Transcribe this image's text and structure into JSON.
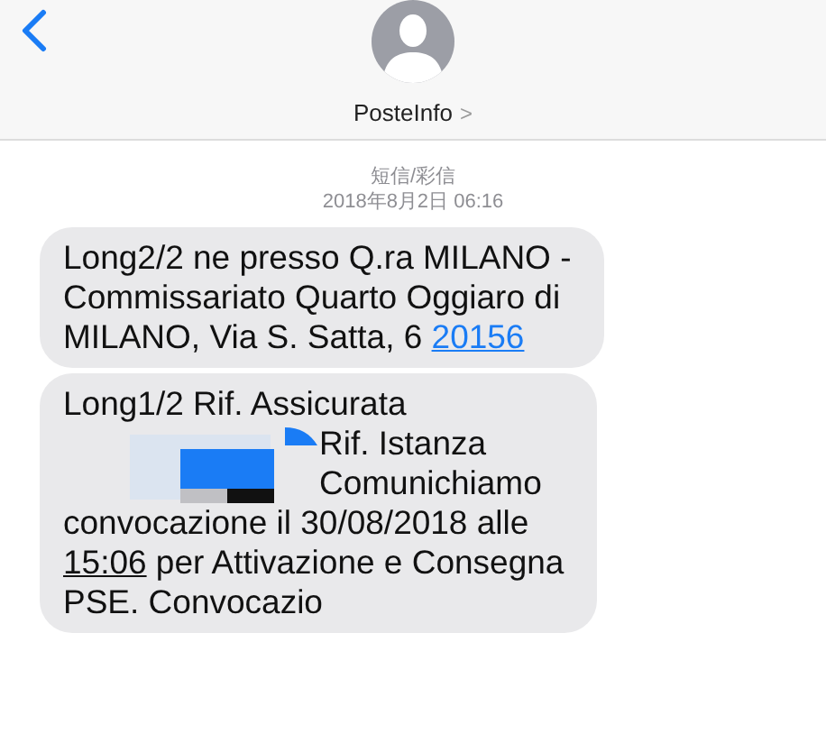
{
  "header": {
    "contact_name": "PosteInfo",
    "chevron": ">"
  },
  "thread_label": "短信/彩信",
  "timestamp": "2018年8月2日 06:16",
  "messages": [
    {
      "lines": [
        {
          "kind": "text",
          "segments": [
            {
              "kind": "plain",
              "text": "Long2/2 ne presso Q.ra MILANO -"
            }
          ]
        },
        {
          "kind": "text",
          "segments": [
            {
              "kind": "plain",
              "text": "Commissariato Quarto Oggiaro di"
            }
          ]
        },
        {
          "kind": "text",
          "segments": [
            {
              "kind": "plain",
              "text": "MILANO, Via S. Satta, 6 "
            },
            {
              "kind": "link",
              "text": "20156"
            }
          ]
        }
      ]
    },
    {
      "lines": [
        {
          "kind": "text",
          "segments": [
            {
              "kind": "plain",
              "text": "Long1/2 Rif. Assicurata"
            }
          ]
        },
        {
          "kind": "redacted",
          "segments": [
            {
              "kind": "plain",
              "text": "Rif. Istanza"
            }
          ]
        },
        {
          "kind": "redacted",
          "segments": [
            {
              "kind": "plain",
              "text": "Comunichiamo"
            }
          ]
        },
        {
          "kind": "text",
          "segments": [
            {
              "kind": "plain",
              "text": "convocazione il 30/08/2018 alle"
            }
          ]
        },
        {
          "kind": "text",
          "segments": [
            {
              "kind": "underlined",
              "text": "15:06"
            },
            {
              "kind": "plain",
              "text": " per Attivazione e Consegna"
            }
          ]
        },
        {
          "kind": "text",
          "segments": [
            {
              "kind": "plain",
              "text": "PSE. Convocazio"
            }
          ]
        }
      ]
    }
  ]
}
